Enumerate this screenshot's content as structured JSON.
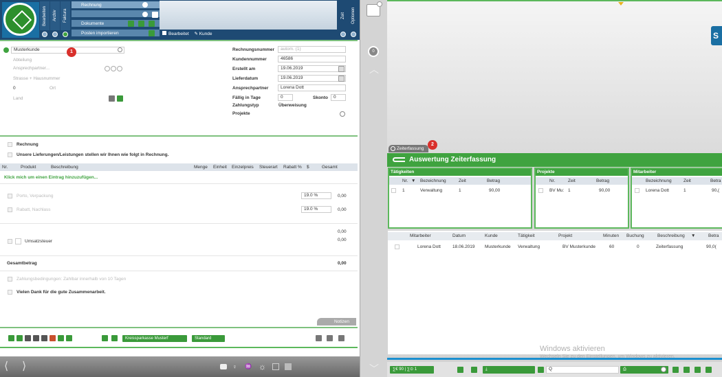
{
  "header": {
    "vtabs": [
      "Bearbeiten",
      "Archiv",
      "Faktura"
    ],
    "vtabs_right": [
      "Zeit",
      "Optionen"
    ],
    "bars": [
      "Rechnung",
      "",
      "Dokumente",
      "Posten importieren"
    ],
    "filter_items": [
      "Bearbeitet",
      "Kunde"
    ]
  },
  "customer": {
    "name": "Musterkunde",
    "badge": "1",
    "fields": [
      "Abteilung",
      "Ansprechpartner...",
      "Strasse + Hausnummer",
      "0",
      "Ort",
      "Land"
    ]
  },
  "invoice": {
    "labels": [
      "Rechnungsnummer",
      "Kundennummer",
      "Erstellt am",
      "Lieferdatum",
      "Ansprechpartner",
      "Fällig in Tage",
      "Zahlungstyp",
      "Projekte"
    ],
    "rechnungsnummer": "autom. (1)",
    "kundennummer": "46586",
    "erstellt_am": "19.06.2019",
    "lieferdatum": "19.06.2019",
    "ansprechpartner": "Lorena Dott",
    "faellig": "0",
    "skonto_label": "Skonto",
    "skonto": "0",
    "zahlungstyp": "Überweisung"
  },
  "body": {
    "title": "Rechnung",
    "intro": "Unsere Lieferungen/Leistungen stellen wir Ihnen wie folgt in Rechnung.",
    "columns": [
      "Nr.",
      "Produkt",
      "Beschreibung",
      "Menge",
      "Einheit",
      "Einzelpreis",
      "Steuerart",
      "Rabatt %",
      "$",
      "Gesamt"
    ],
    "add_entry": "Klick mich um einen Eintrag hinzuzufügen...",
    "porto": "Porto, Verpackung",
    "rabatt": "Rabatt, Nachlass",
    "tax_rate_1": "19.0 %",
    "tax_rate_2": "19.0 %",
    "amount_1": "0,00",
    "amount_2": "0,00",
    "sum_1": "0,00",
    "sum_2": "0,00",
    "umsatzsteuer": "Umsatzsteuer",
    "gesamtbetrag": "Gesamtbetrag",
    "gesamt_value": "0,00",
    "zahlung": "Zahlungsbedingungen: Zahlbar innerhalb von 10 Tagen",
    "danke": "Vielen Dank für die gute Zusammenarbeit.",
    "notizen": "Notizen"
  },
  "footer": {
    "bank": "Kreissparkasse Musterf",
    "standard": "Standard"
  },
  "zeit": {
    "tab": "Zeiterfassung",
    "badge": "2",
    "title": "Auswertung Zeiterfassung",
    "taetigkeiten": {
      "title": "Tätigkeiten",
      "cols": [
        "Nr.",
        "Bezeichnung",
        "Zeit",
        "Betrag"
      ],
      "rows": [
        [
          "1",
          "Verwaltung",
          "1",
          "90,00"
        ]
      ]
    },
    "projekte": {
      "title": "Projekte",
      "cols": [
        "Nr.",
        "Zeit",
        "Betrag"
      ],
      "rows": [
        [
          "BV Mu:",
          "1",
          "90,00"
        ]
      ]
    },
    "mitarbeiter": {
      "title": "Mitarbeiter",
      "cols": [
        "Bezeichnung",
        "Zeit",
        "Betra"
      ],
      "rows": [
        [
          "Lorena Dott",
          "1",
          "90,("
        ]
      ]
    },
    "detail": {
      "cols": [
        "Mitarbeiter",
        "Datum",
        "Kunde",
        "Tätigkeit",
        "Projekt",
        "Minuten",
        "Buchung",
        "Beschreibung",
        "Betra"
      ],
      "rows": [
        [
          "Lorena Dott",
          "18.06.2019",
          "Musterkunde",
          "Verwaltung",
          "BV Musterkunde",
          "60",
          "0",
          "Zeiterfassung",
          "90,0("
        ]
      ]
    },
    "status": "∑€ 90 | ∑⊙ 1",
    "search_value": "Q",
    "watermark_1": "Windows aktivieren",
    "watermark_2": "Wechseln Sie zu den Einstellungen, um Windows zu aktivieren."
  },
  "sidebar_counter": "0"
}
